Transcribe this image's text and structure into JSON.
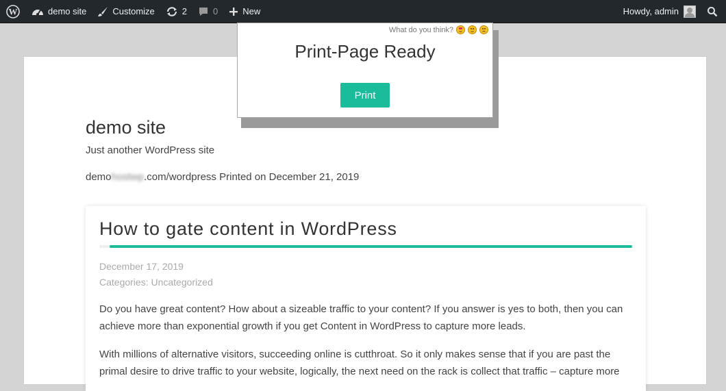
{
  "adminbar": {
    "site_name": "demo site",
    "customize": "Customize",
    "updates_count": "2",
    "comments_count": "0",
    "new_label": "New",
    "howdy": "Howdy, admin"
  },
  "site": {
    "title": "demo site",
    "description": "Just another WordPress site",
    "url_prefix": "demo",
    "url_blurred": "hostwp",
    "url_suffix": ".com/wordpress",
    "printed_on": "Printed on December 21, 2019"
  },
  "post": {
    "title": "How to gate content in WordPress",
    "date": "December 17, 2019",
    "categories": "Categories: Uncategorized",
    "paragraphs": [
      "Do you have great content? How about a sizeable traffic to your content? If you answer is yes to both, then you can achieve more than exponential growth if you get Content in WordPress to capture more leads.",
      "With millions of alternative visitors, succeeding online is cutthroat. So it only makes sense that if you are past the primal desire to drive traffic to your website, logically, the next need on the rack is collect that traffic – capture more"
    ]
  },
  "popup": {
    "feedback_label": "What do you think?",
    "title": "Print-Page Ready",
    "print_button": "Print"
  },
  "colors": {
    "accent": "#1abc9c",
    "adminbar_bg": "#23282d"
  },
  "icons": {
    "wp": "wordpress-logo-icon",
    "dashboard": "dashboard-icon",
    "customize": "brush-icon",
    "updates": "updates-icon",
    "comments": "comment-icon",
    "new": "plus-icon"
  }
}
